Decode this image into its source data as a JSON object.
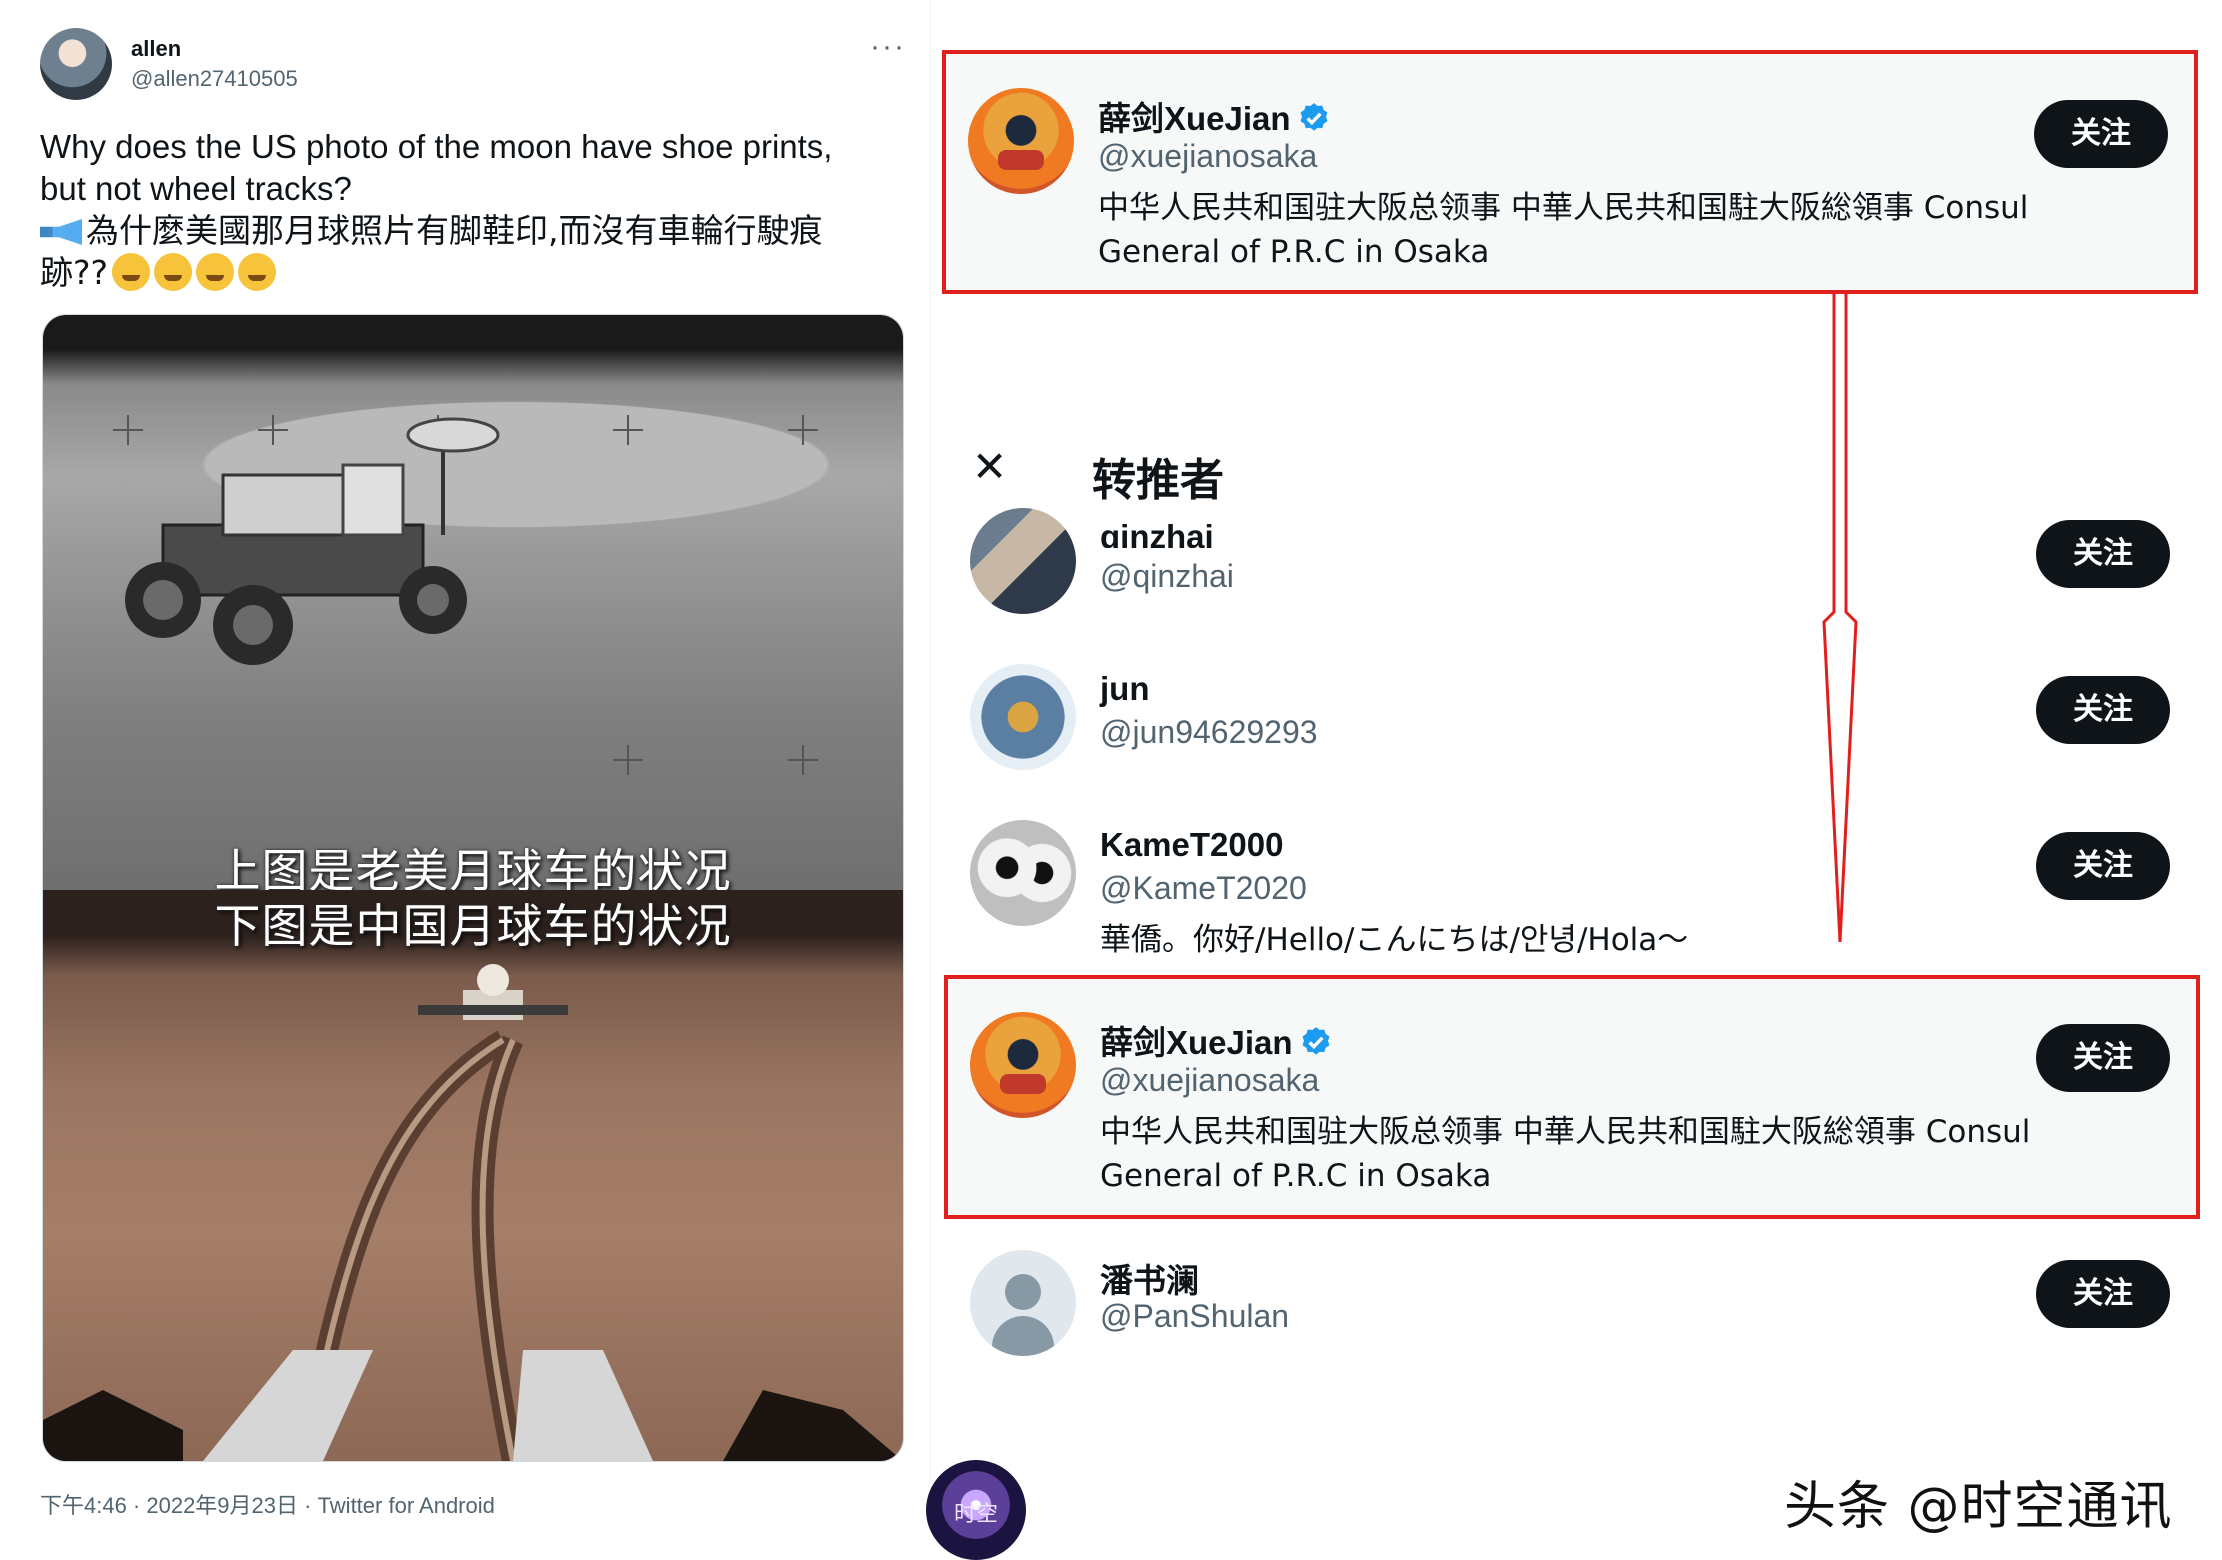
{
  "tweet": {
    "author_name": "allen",
    "author_handle": "@allen27410505",
    "more_icon": "···",
    "text_en_line1": "Why does the US photo of the moon have shoe prints,",
    "text_en_line2": "but not wheel tracks?",
    "text_zh_line1": "為什麼美國那月球照片有脚鞋印,而沒有車輪行駛痕",
    "text_zh_line2": "跡??",
    "image_caption_top": "上图是老美月球车的状况",
    "image_caption_bottom": "下图是中国月球车的状况",
    "timestamp": "下午4:46 · 2022年9月23日 · Twitter for Android"
  },
  "highlight_top": {
    "name": "薛剑XueJian",
    "handle": "@xuejianosaka",
    "bio_line1": "中华人民共和国驻大阪总领事 中華人民共和国駐大阪総領事 Consul",
    "bio_line2": "General of P.R.C in Osaka",
    "follow_label": "关注"
  },
  "retweeters": {
    "close_icon": "✕",
    "title": "转推者",
    "users": [
      {
        "name": "qinzhai",
        "handle": "@qinzhai",
        "bio": "",
        "follow_label": "关注"
      },
      {
        "name": "jun",
        "handle": "@jun94629293",
        "bio": "",
        "follow_label": "关注"
      },
      {
        "name": "KameT2000",
        "handle": "@KameT2020",
        "bio": "華僑。你好/Hello/こんにちは/안녕/Hola〜",
        "follow_label": "关注"
      },
      {
        "name": "薛剑XueJian",
        "handle": "@xuejianosaka",
        "bio_line1": "中华人民共和国驻大阪总领事 中華人民共和国駐大阪総領事 Consul",
        "bio_line2": "General of P.R.C in Osaka",
        "follow_label": "关注"
      },
      {
        "name": "潘书澜",
        "handle": "@PanShulan",
        "bio": "",
        "follow_label": "关注"
      }
    ]
  },
  "watermark": {
    "logo_text": "时空",
    "text": "头条 @时空通讯"
  },
  "colors": {
    "highlight": "#e0201c",
    "verified": "#1d9bf0",
    "button": "#0f1419"
  }
}
